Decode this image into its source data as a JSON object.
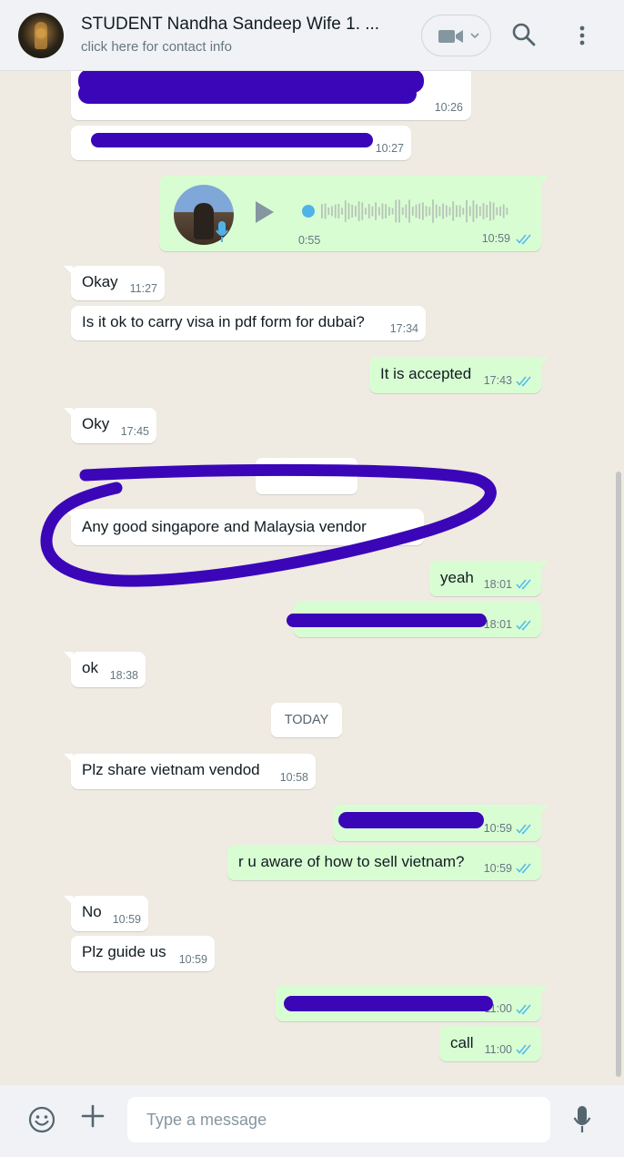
{
  "header": {
    "title": "STUDENT Nandha Sandeep Wife 1. ...",
    "subtitle": "click here for contact info",
    "video_icon": "video-camera-icon",
    "search_icon": "search-icon",
    "menu_icon": "kebab-menu-icon"
  },
  "colors": {
    "incoming_bubble": "#ffffff",
    "outgoing_bubble": "#d9fdd3",
    "read_ticks": "#53bdeb",
    "chat_background": "#efeae2",
    "redaction_marker": "#3b06b8"
  },
  "messages": [
    {
      "id": "m1",
      "time": "10:26"
    },
    {
      "id": "m2",
      "time": "10:27"
    },
    {
      "id": "m3",
      "duration": "0:55",
      "time": "10:59"
    },
    {
      "id": "m4",
      "text": "Okay",
      "time": "11:27"
    },
    {
      "id": "m5",
      "text": "Is it ok to carry visa in pdf form for dubai?",
      "time": "17:34"
    },
    {
      "id": "m6",
      "text": "It is accepted",
      "time": "17:43"
    },
    {
      "id": "m7",
      "text": "Oky",
      "time": "17:45"
    },
    {
      "id": "m8",
      "text": "Any good singapore and Malaysia vendor"
    },
    {
      "id": "m9",
      "text": "yeah",
      "time": "18:01"
    },
    {
      "id": "m10",
      "time": "18:01"
    },
    {
      "id": "m11",
      "text": "ok",
      "time": "18:38"
    },
    {
      "id": "m12",
      "text": "Plz share  vietnam vendod",
      "time": "10:58"
    },
    {
      "id": "m13",
      "time": "10:59"
    },
    {
      "id": "m14",
      "text": "r u aware of how to sell vietnam?",
      "time": "10:59"
    },
    {
      "id": "m15",
      "text": "No",
      "time": "10:59"
    },
    {
      "id": "m16",
      "text": "Plz guide us",
      "time": "10:59"
    },
    {
      "id": "m17",
      "time": "11:00"
    },
    {
      "id": "m18",
      "text": "call",
      "time": "11:00"
    }
  ],
  "date_chip": "TODAY",
  "composer": {
    "placeholder": "Type a message",
    "emoji_icon": "emoji-icon",
    "attach_icon": "plus-icon",
    "mic_icon": "microphone-icon"
  }
}
